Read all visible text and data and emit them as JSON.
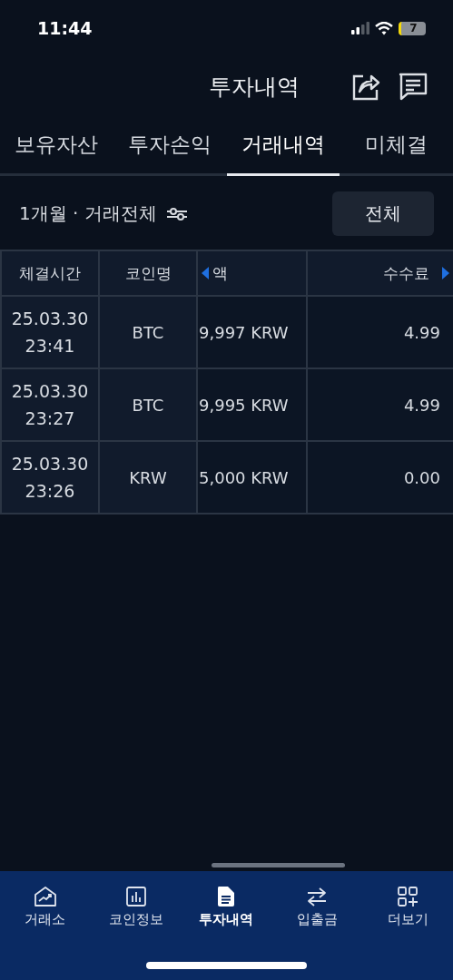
{
  "status_bar": {
    "time": "11:44",
    "battery": "7"
  },
  "header": {
    "title": "투자내역"
  },
  "tabs": [
    {
      "label": "보유자산",
      "selected": false
    },
    {
      "label": "투자손익",
      "selected": false
    },
    {
      "label": "거래내역",
      "selected": true
    },
    {
      "label": "미체결",
      "selected": false
    }
  ],
  "filter": {
    "summary": "1개월 · 거래전체",
    "button": "전체"
  },
  "table": {
    "columns": [
      "체결시간",
      "코인명",
      "액",
      "수수료"
    ],
    "rows": [
      {
        "time": [
          "25.03.30",
          "23:41"
        ],
        "coin": "BTC",
        "amount": "9,997 KRW",
        "fee": "4.99"
      },
      {
        "time": [
          "25.03.30",
          "23:27"
        ],
        "coin": "BTC",
        "amount": "9,995 KRW",
        "fee": "4.99"
      },
      {
        "time": [
          "25.03.30",
          "23:26"
        ],
        "coin": "KRW",
        "amount": "5,000 KRW",
        "fee": "0.00"
      }
    ]
  },
  "bottom_nav": [
    {
      "label": "거래소",
      "selected": false
    },
    {
      "label": "코인정보",
      "selected": false
    },
    {
      "label": "투자내역",
      "selected": true
    },
    {
      "label": "입출금",
      "selected": false
    },
    {
      "label": "더보기",
      "selected": false
    }
  ]
}
